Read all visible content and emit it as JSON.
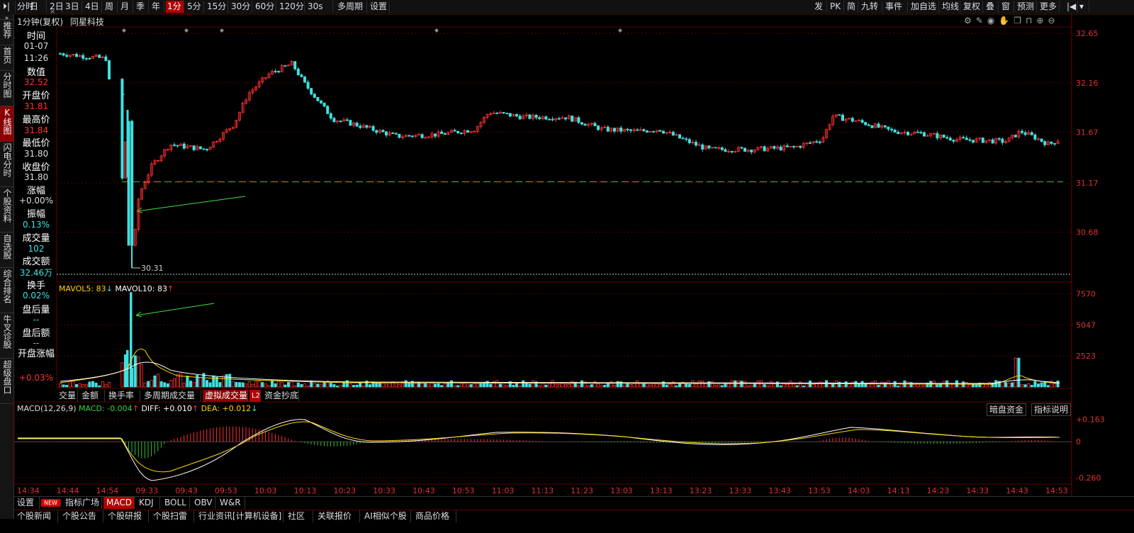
{
  "toolbar": {
    "left_buttons": [
      {
        "label": "分时"
      },
      {
        "label": "日"
      },
      {
        "label": "2日"
      },
      {
        "label": "3日"
      },
      {
        "label": "4日"
      },
      {
        "label": "周"
      },
      {
        "label": "月"
      },
      {
        "label": "季"
      },
      {
        "label": "年"
      },
      {
        "label": "1分",
        "active": true
      },
      {
        "label": "5分"
      },
      {
        "label": "15分"
      },
      {
        "label": "30分"
      },
      {
        "label": "60分"
      },
      {
        "label": "120分"
      },
      {
        "label": "30s"
      },
      {
        "label": "多周期"
      },
      {
        "label": "设置"
      }
    ],
    "right_buttons": [
      {
        "label": "发"
      },
      {
        "label": "PK"
      },
      {
        "label": "简"
      },
      {
        "label": "九转"
      },
      {
        "label": "事件"
      },
      {
        "label": "加自选"
      },
      {
        "label": "均线"
      },
      {
        "label": "复权"
      },
      {
        "label": "叠"
      },
      {
        "label": "窗"
      },
      {
        "label": "预测"
      },
      {
        "label": "更多"
      }
    ]
  },
  "leftnav": [
    {
      "label": "推荐"
    },
    {
      "label": "首页"
    },
    {
      "label": "分时图"
    },
    {
      "label": "K线图",
      "active": true
    },
    {
      "label": "闪电分时"
    },
    {
      "label": "个股资料"
    },
    {
      "label": "自选股"
    },
    {
      "label": "综合排名"
    },
    {
      "label": "牛叉诊股"
    },
    {
      "label": "超级盘口"
    }
  ],
  "header": {
    "period": "1分钟(复权)",
    "stock_name": "同星科技"
  },
  "info_panel": {
    "time_label": "时间",
    "date": "01-07",
    "time": "11:26",
    "value_label": "数值",
    "value": "32.52",
    "open_label": "开盘价",
    "open": "31.81",
    "high_label": "最高价",
    "high": "31.84",
    "low_label": "最低价",
    "low": "31.80",
    "close_label": "收盘价",
    "close": "31.80",
    "change_label": "涨幅",
    "change": "+0.00%",
    "amplitude_label": "振幅",
    "amplitude": "0.13%",
    "volume_label": "成交量",
    "volume": "102",
    "amount_label": "成交额",
    "amount": "32.46万",
    "turnover_label": "换手",
    "turnover": "0.02%",
    "after_vol_label": "盘后量",
    "after_vol": "--",
    "after_amt_label": "盘后额",
    "after_amt": "--",
    "open_change_label": "开盘涨幅",
    "open_change": "+0.03%"
  },
  "chart_data": [
    {
      "type": "candlestick",
      "y_ticks": [
        "32.65",
        "32.16",
        "31.67",
        "31.17",
        "30.68"
      ],
      "low_marker": "30.31",
      "ylim": [
        30.2,
        32.7
      ],
      "ref_line": 31.18
    },
    {
      "type": "bar",
      "title": "MAVOL5: 83 MAVOL10: 83",
      "mavol5_label": "MAVOL5: 83",
      "mavol10_label": "MAVOL10: 83",
      "y_ticks": [
        "7570",
        "5047",
        "2523"
      ],
      "ylim": [
        0,
        8400
      ]
    },
    {
      "type": "line",
      "title": "MACD(12,26,9)",
      "macd_label": "MACD: -0.004",
      "diff_label": "DIFF: +0.010",
      "dea_label": "DEA: +0.012",
      "y_ticks": [
        "+0.163",
        "0",
        "-0.260"
      ],
      "ylim": [
        -0.3,
        0.2
      ]
    }
  ],
  "volume_tabs": [
    {
      "label": "交量"
    },
    {
      "label": "金额"
    },
    {
      "label": "换手率"
    },
    {
      "label": "多周期成交量"
    },
    {
      "label": "虚拟成交量",
      "active": true
    },
    {
      "label": "L2"
    },
    {
      "label": "资金抄底"
    }
  ],
  "macd_buttons": {
    "dark_money": "暗盘资金",
    "indicator_help": "指标说明"
  },
  "time_axis": [
    "14:34",
    "14:44",
    "14:54",
    "09:33",
    "09:43",
    "09:53",
    "10:03",
    "10:13",
    "10:23",
    "10:33",
    "10:43",
    "10:53",
    "11:03",
    "11:13",
    "11:23",
    "13:03",
    "13:13",
    "13:23",
    "13:33",
    "13:43",
    "13:53",
    "14:03",
    "14:13",
    "14:23",
    "14:33",
    "14:43",
    "14:53"
  ],
  "bottom_tabs": [
    {
      "label": "设置"
    },
    {
      "label": "NEW"
    },
    {
      "label": "指标广场"
    },
    {
      "label": "MACD",
      "active": true
    },
    {
      "label": "KDJ"
    },
    {
      "label": "BOLL"
    },
    {
      "label": "OBV"
    },
    {
      "label": "W&R"
    }
  ],
  "news_tabs": [
    {
      "label": "个股新闻"
    },
    {
      "label": "个股公告"
    },
    {
      "label": "个股研报"
    },
    {
      "label": "个股扫雷"
    },
    {
      "label": "行业资讯[计算机设备]"
    },
    {
      "label": "社区"
    },
    {
      "label": "关联报价"
    },
    {
      "label": "AI相似个股"
    },
    {
      "label": "商品价格"
    }
  ],
  "colors": {
    "up": "#ff3030",
    "down": "#40e0e0",
    "ma_white": "#ffffff",
    "ma_yellow": "#ffd700",
    "grid": "#5a0000"
  }
}
